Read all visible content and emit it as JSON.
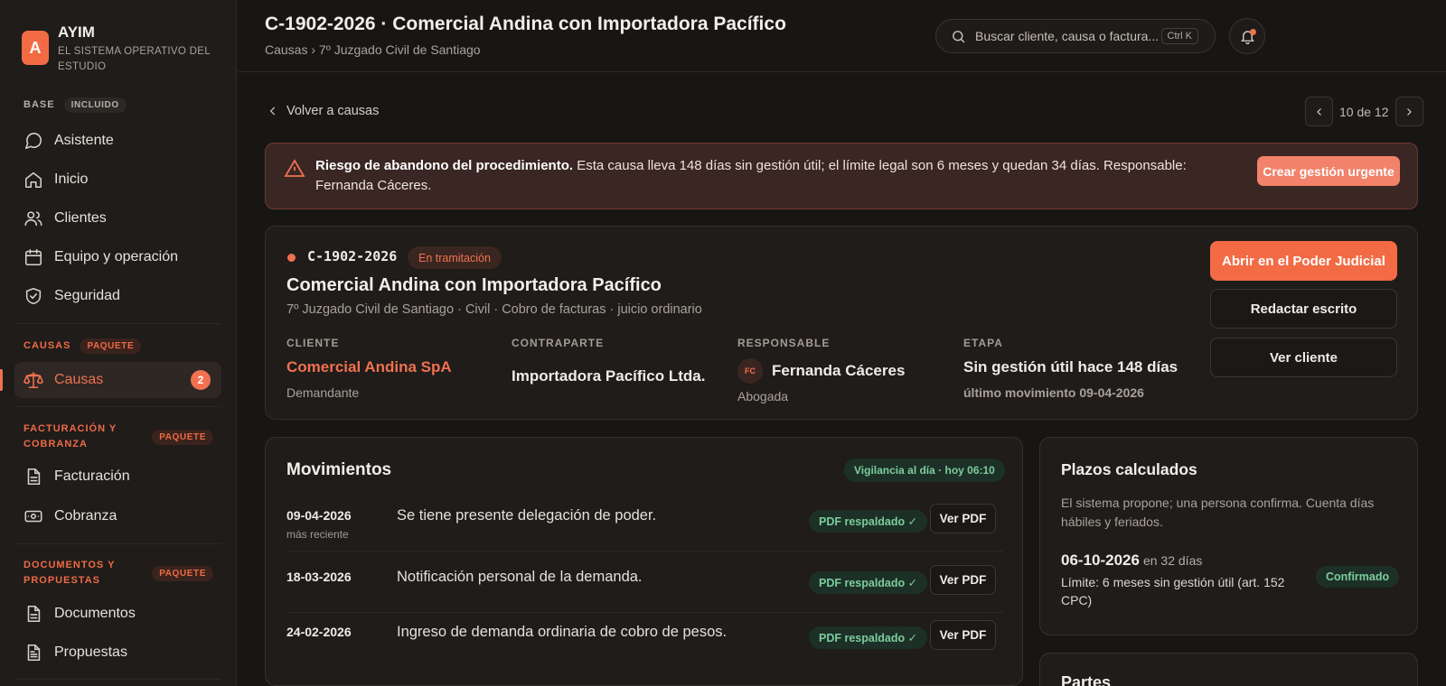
{
  "brand": {
    "logo_letter": "A",
    "name": "AYIM",
    "tagline": "EL SISTEMA OPERATIVO DEL ESTUDIO"
  },
  "sidebar": {
    "sections": [
      {
        "title": "BASE",
        "pill": "INCLUIDO"
      },
      {
        "title": "CAUSAS",
        "pill": "PAQUETE"
      },
      {
        "title": "FACTURACIÓN Y COBRANZA",
        "pill": "PAQUETE"
      },
      {
        "title": "DOCUMENTOS Y PROPUESTAS",
        "pill": "PAQUETE"
      }
    ],
    "items": [
      {
        "label": "Asistente",
        "icon": "chat-bubble-icon"
      },
      {
        "label": "Inicio",
        "icon": "home-icon"
      },
      {
        "label": "Clientes",
        "icon": "users-icon"
      },
      {
        "label": "Equipo y operación",
        "icon": "calendar-icon"
      },
      {
        "label": "Seguridad",
        "icon": "shield-check-icon"
      },
      {
        "label": "Causas",
        "icon": "scale-icon",
        "badge": "2",
        "active": true
      },
      {
        "label": "Facturación",
        "icon": "document-icon"
      },
      {
        "label": "Cobranza",
        "icon": "banknote-icon"
      },
      {
        "label": "Documentos",
        "icon": "document-icon"
      },
      {
        "label": "Propuestas",
        "icon": "document-lines-icon"
      }
    ]
  },
  "header": {
    "title": "C-1902-2026 · Comercial Andina con Importadora Pacífico",
    "breadcrumb": "Causas › 7º Juzgado Civil de Santiago",
    "search_placeholder": "Buscar cliente, causa o factura...",
    "search_shortcut": "Ctrl K"
  },
  "nav": {
    "back_label": "Volver a causas",
    "pager_text": "10 de 12"
  },
  "alert": {
    "bold": "Riesgo de abandono del procedimiento.",
    "text": " Esta causa lleva 148 días sin gestión útil; el límite legal son 6 meses y quedan 34 días. Responsable: Fernanda Cáceres.",
    "button": "Crear gestión urgente"
  },
  "case": {
    "code": "C-1902-2026",
    "status": "En tramitación",
    "title": "Comercial Andina con Importadora Pacífico",
    "subtitle": "7º Juzgado Civil de Santiago · Civil · Cobro de facturas · juicio ordinario",
    "client_label": "CLIENTE",
    "client_value": "Comercial Andina SpA",
    "client_role": "Demandante",
    "counter_label": "CONTRAPARTE",
    "counter_value": "Importadora Pacífico Ltda.",
    "resp_label": "RESPONSABLE",
    "resp_initials": "FC",
    "resp_name": "Fernanda Cáceres",
    "resp_role": "Abogada",
    "stage_label": "ETAPA",
    "stage_value": "Sin gestión útil hace 148 días",
    "stage_note": "último movimiento 09-04-2026",
    "btn_open": "Abrir en el Poder Judicial",
    "btn_write": "Redactar escrito",
    "btn_client": "Ver cliente"
  },
  "movements": {
    "title": "Movimientos",
    "watch": "Vigilancia al día · hoy 06:10",
    "rows": [
      {
        "date": "09-04-2026",
        "note": "más reciente",
        "desc": "Se tiene presente delegación de poder.",
        "pill": "PDF respaldado ✓",
        "button": "Ver PDF"
      },
      {
        "date": "18-03-2026",
        "note": "",
        "desc": "Notificación personal de la demanda.",
        "pill": "PDF respaldado ✓",
        "button": "Ver PDF"
      },
      {
        "date": "24-02-2026",
        "note": "",
        "desc": "Ingreso de demanda ordinaria de cobro de pesos.",
        "pill": "PDF respaldado ✓",
        "button": "Ver PDF"
      }
    ]
  },
  "deadlines": {
    "title": "Plazos calculados",
    "desc": "El sistema propone; una persona confirma. Cuenta días hábiles y feriados.",
    "date": "06-10-2026",
    "relative": "en 32 días",
    "limit": "Límite: 6 meses sin gestión útil (art. 152 CPC)",
    "status": "Confirmado"
  },
  "parties": {
    "title": "Partes"
  },
  "colors": {
    "accent": "#f26b45",
    "success": "#7ccc9c",
    "background": "#181615",
    "card": "#1f1c1a"
  }
}
